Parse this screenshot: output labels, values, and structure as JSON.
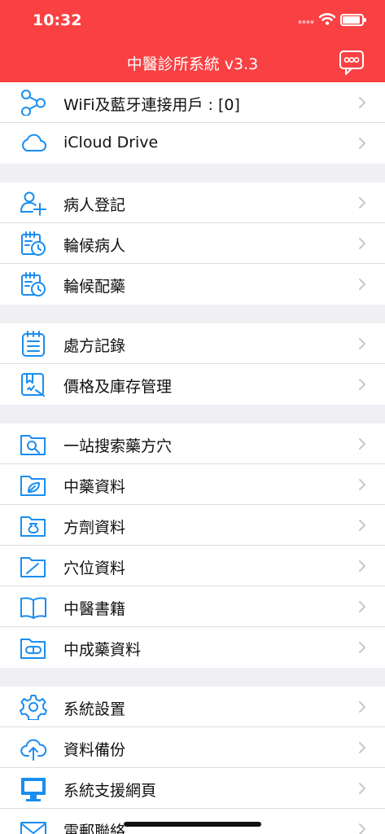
{
  "status_bar": {
    "time": "10:32"
  },
  "nav": {
    "title": "中醫診所系統 v3.3"
  },
  "sections": [
    {
      "items": [
        {
          "name": "menu-item-wifi-bluetooth-users",
          "label": "WiFi及藍牙連接用戶 : [0]",
          "icon": "share-nodes-icon"
        },
        {
          "name": "menu-item-icloud-drive",
          "label": "iCloud Drive",
          "icon": "cloud-icon"
        }
      ]
    },
    {
      "items": [
        {
          "name": "menu-item-patient-registration",
          "label": "病人登記",
          "icon": "add-user-icon"
        },
        {
          "name": "menu-item-waiting-patients",
          "label": "輪候病人",
          "icon": "calendar-clock-icon"
        },
        {
          "name": "menu-item-waiting-dispensing",
          "label": "輪候配藥",
          "icon": "calendar-clock-icon"
        }
      ]
    },
    {
      "items": [
        {
          "name": "menu-item-prescription-records",
          "label": "處方記錄",
          "icon": "notepad-icon"
        },
        {
          "name": "menu-item-price-inventory",
          "label": "價格及庫存管理",
          "icon": "price-tag-icon"
        }
      ]
    },
    {
      "items": [
        {
          "name": "menu-item-one-stop-search",
          "label": "一站搜索藥方穴",
          "icon": "folder-search-icon"
        },
        {
          "name": "menu-item-herb-data",
          "label": "中藥資料",
          "icon": "folder-leaf-icon"
        },
        {
          "name": "menu-item-formula-data",
          "label": "方劑資料",
          "icon": "folder-pouch-icon"
        },
        {
          "name": "menu-item-acupoint-data",
          "label": "穴位資料",
          "icon": "folder-needle-icon"
        },
        {
          "name": "menu-item-tcm-books",
          "label": "中醫書籍",
          "icon": "open-book-icon"
        },
        {
          "name": "menu-item-patent-medicine-data",
          "label": "中成藥資料",
          "icon": "folder-capsule-icon"
        }
      ]
    },
    {
      "items": [
        {
          "name": "menu-item-system-settings",
          "label": "系統設置",
          "icon": "gear-icon"
        },
        {
          "name": "menu-item-data-backup",
          "label": "資料備份",
          "icon": "cloud-upload-icon"
        },
        {
          "name": "menu-item-support-website",
          "label": "系統支援網頁",
          "icon": "monitor-icon"
        },
        {
          "name": "menu-item-email-contact",
          "label": "電郵聯絡",
          "icon": "envelope-icon"
        }
      ]
    }
  ],
  "colors": {
    "header": "#f94143",
    "icon": "#1a8df0",
    "chevron": "#c7c7cc",
    "section_gap": "#efeff4"
  }
}
